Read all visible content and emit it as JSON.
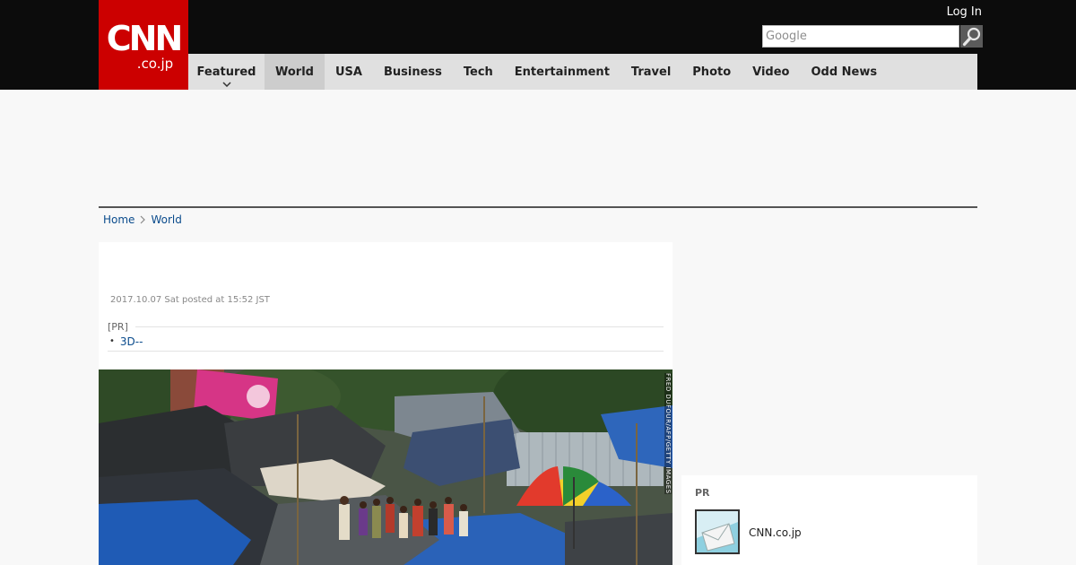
{
  "header": {
    "logo_main": "CNN",
    "logo_sub": ".co.jp",
    "login_label": "Log In",
    "search_placeholder": "Google"
  },
  "nav": {
    "items": [
      {
        "label": "Featured"
      },
      {
        "label": "World"
      },
      {
        "label": "USA"
      },
      {
        "label": "Business"
      },
      {
        "label": "Tech"
      },
      {
        "label": "Entertainment"
      },
      {
        "label": "Travel"
      },
      {
        "label": "Photo"
      },
      {
        "label": "Video"
      },
      {
        "label": "Odd News"
      }
    ],
    "active": "World"
  },
  "breadcrumb": {
    "home": "Home",
    "current": "World"
  },
  "article": {
    "posted": "2017.10.07 Sat posted at 15:52 JST",
    "pr_label": "[PR]",
    "pr_link": "3D--",
    "photo_credit": "FRED DUFOUR/AFP/GETTY IMAGES"
  },
  "sidebar": {
    "pr_label": "PR",
    "pr_item_text": "CNN.co.jp"
  },
  "colors": {
    "brand_red": "#cc0000",
    "link_blue": "#0a4b8c",
    "topbar": "#0c0c0c",
    "nav_bg": "#e0e0e0"
  }
}
